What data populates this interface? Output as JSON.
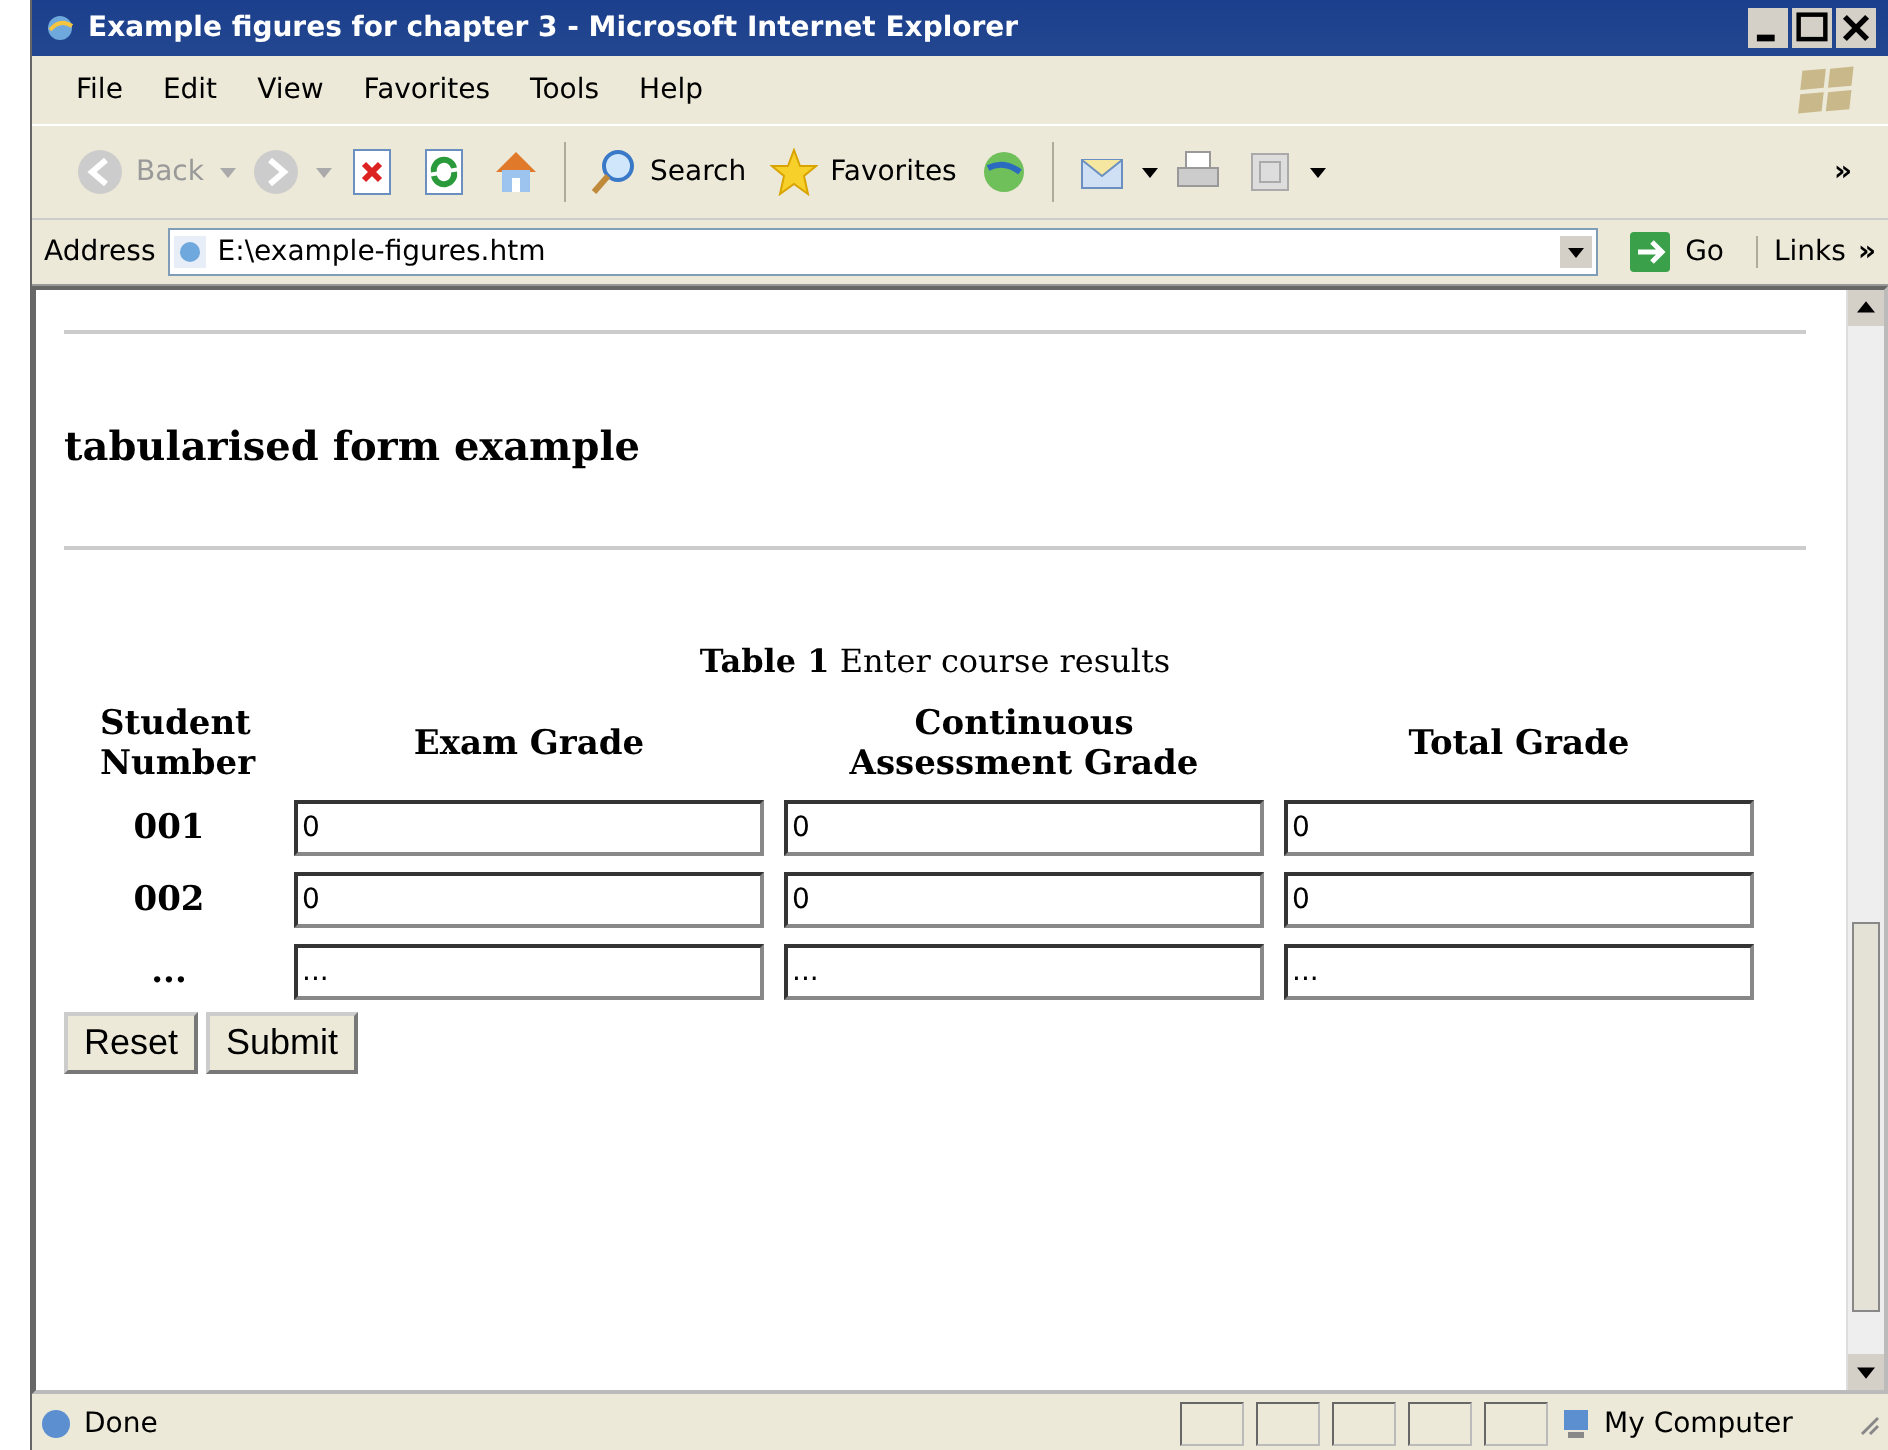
{
  "window": {
    "title": "Example figures for chapter 3 - Microsoft Internet Explorer"
  },
  "menu": [
    "File",
    "Edit",
    "View",
    "Favorites",
    "Tools",
    "Help"
  ],
  "toolbar": {
    "back": "Back",
    "search": "Search",
    "favorites": "Favorites",
    "more": "»"
  },
  "address": {
    "label": "Address",
    "value": "E:\\example-figures.htm",
    "go": "Go",
    "links": "Links",
    "more": "»"
  },
  "page": {
    "heading": "tabularised form example",
    "caption": "**Table 1** Enter course results",
    "columns": [
      "Student Number",
      "Exam Grade",
      "Continuous Assessment Grade",
      "Total Grade"
    ],
    "rows": [
      {
        "student": "001",
        "values": [
          "0",
          "0",
          "0"
        ]
      },
      {
        "student": "002",
        "values": [
          "0",
          "0",
          "0"
        ]
      },
      {
        "student": "...",
        "values": [
          "...",
          "...",
          "..."
        ]
      }
    ],
    "buttons": [
      "Reset",
      "Submit"
    ]
  },
  "status_bar": {
    "text": "Done",
    "zone": "My Computer"
  }
}
